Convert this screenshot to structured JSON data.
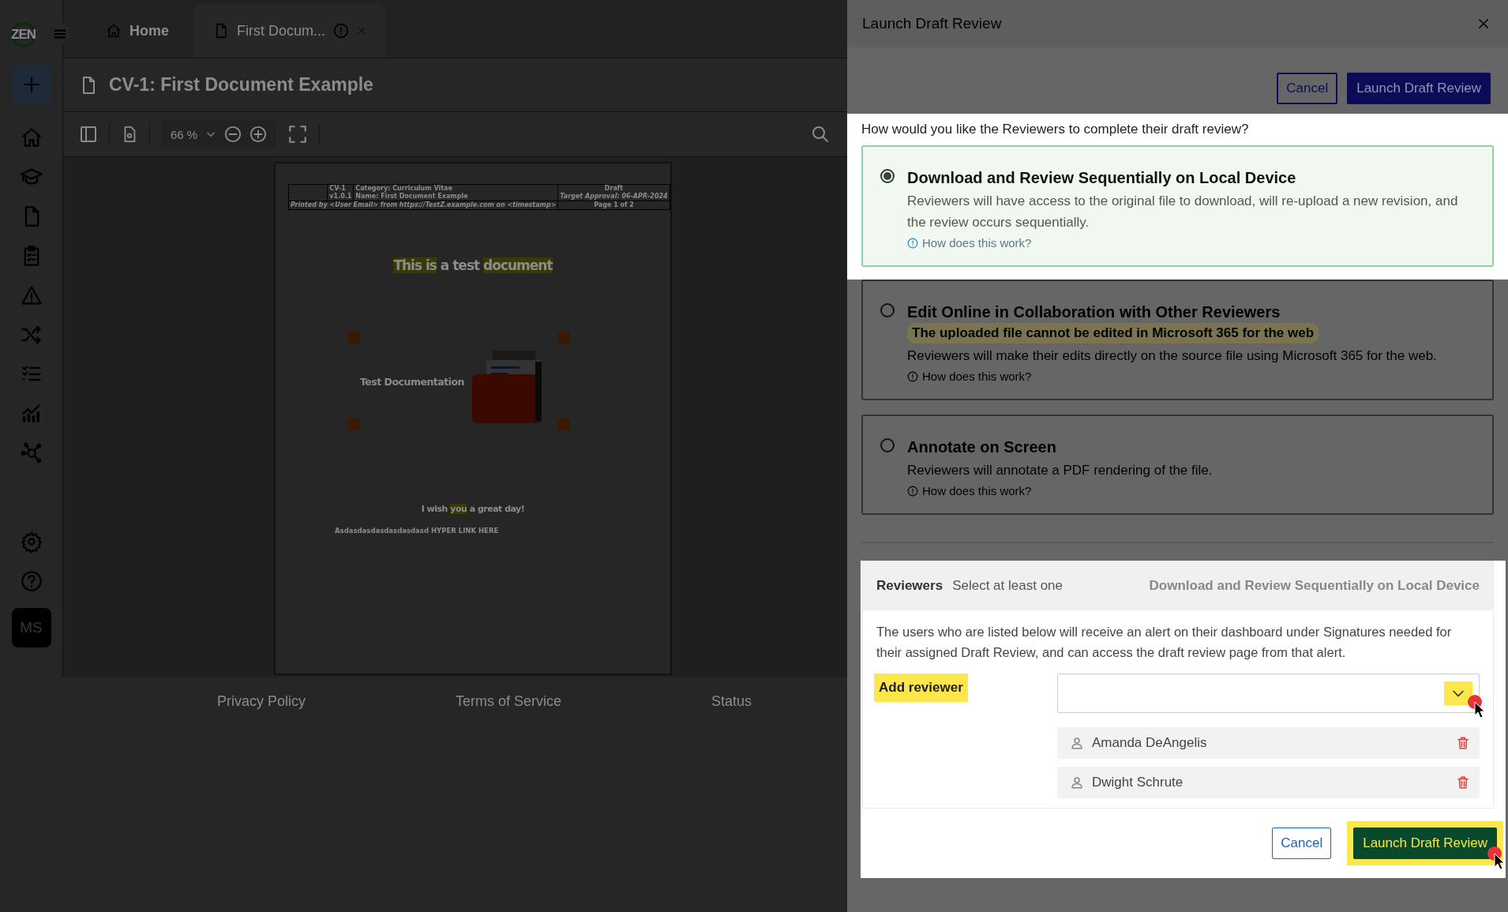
{
  "sidebar": {
    "logo": "ZEN",
    "avatar": "MS"
  },
  "tabs": [
    {
      "label": "Home",
      "kind": "home",
      "selected": false,
      "warning": false,
      "closable": false
    },
    {
      "label": "First Docum...",
      "kind": "document",
      "selected": true,
      "warning": true,
      "closable": true
    }
  ],
  "document_title": "CV-1: First Document Example",
  "toolbar": {
    "zoom": "66 %"
  },
  "document": {
    "header": {
      "code": "CV-1",
      "version": "v1.0.1",
      "category": "Category: Curriculum Vitae",
      "name": "Name: First Document Example",
      "status": "Draft",
      "target": "Target Approval: 06-APR-2024",
      "printed": "Printed by <User Email> from https://TestZ.example.com on <timestamp>",
      "page": "Page 1 of 2"
    },
    "heading": [
      {
        "text": "This is",
        "highlighted": true
      },
      {
        "text": " a test ",
        "highlighted": false
      },
      {
        "text": "document",
        "highlighted": true
      }
    ],
    "image_caption": "Test Documentation",
    "greeting": [
      {
        "text": "I wish ",
        "highlighted": false
      },
      {
        "text": "you",
        "highlighted": true
      },
      {
        "text": " a great day!",
        "highlighted": false
      }
    ],
    "link_line": "Asdasdasdasdasdasdasd HYPER LINK HERE"
  },
  "footer_links": [
    "Privacy Policy",
    "Terms of Service",
    "Status"
  ],
  "dialog": {
    "title": "Launch Draft Review",
    "top_buttons": [
      {
        "label": "Cancel",
        "kind": "secondary"
      },
      {
        "label": "Launch Draft Review",
        "kind": "primary"
      }
    ],
    "question": {
      "text": "How would you like the Reviewers to complete their draft review?",
      "spotlight": true
    },
    "options": [
      {
        "title": "Download and Review Sequentially on Local Device",
        "description": "Reviewers will have access to the original file to download, will re-upload a new revision, and the review occurs sequentially.",
        "help": "How does this work?",
        "selected": true,
        "spotlight": true
      },
      {
        "title": "Edit Online in Collaboration with Other Reviewers",
        "warning": "The uploaded file cannot be edited in Microsoft 365 for the web",
        "description": "Reviewers will make their edits directly on the source file using Microsoft 365 for the web.",
        "help": "How does this work?",
        "selected": false,
        "spotlight": false
      },
      {
        "title": "Annotate on Screen",
        "description": "Reviewers will annotate a PDF rendering of the file.",
        "help": "How does this work?",
        "selected": false,
        "spotlight": false
      }
    ],
    "reviewers": {
      "title": "Reviewers",
      "hint": "Select at least one",
      "mode": "Download and Review Sequentially on Local Device",
      "description": "The users who are listed below will receive an alert on their dashboard under Signatures needed for their assigned Draft Review, and can access the draft review page from that alert.",
      "add_label": "Add reviewer",
      "add_highlighted": true,
      "dropdown_highlighted": true,
      "dropdown_clicked": true,
      "spotlight": true,
      "people": [
        "Amanda DeAngelis",
        "Dwight Schrute"
      ]
    },
    "bottom_buttons": [
      {
        "label": "Cancel",
        "kind": "secondary",
        "highlighted": false,
        "clicked": false
      },
      {
        "label": "Launch Draft Review",
        "kind": "success",
        "highlighted": true,
        "clicked": true
      }
    ]
  }
}
